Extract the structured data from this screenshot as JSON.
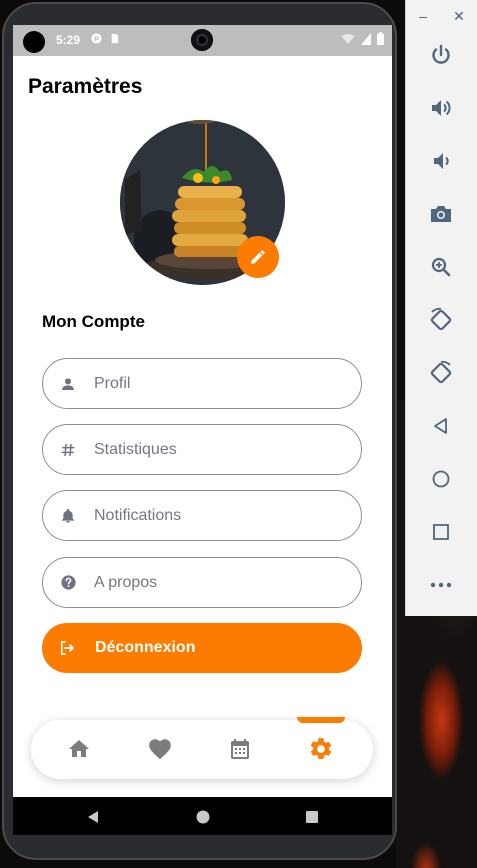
{
  "status_bar": {
    "time": "5:29"
  },
  "page": {
    "title": "Paramètres"
  },
  "account": {
    "section_title": "Mon Compte",
    "items": [
      {
        "label": "Profil",
        "icon": "person-icon"
      },
      {
        "label": "Statistiques",
        "icon": "hash-icon"
      },
      {
        "label": "Notifications",
        "icon": "bell-icon"
      },
      {
        "label": "A propos",
        "icon": "help-icon"
      }
    ],
    "logout_label": "Déconnexion"
  },
  "bottom_nav": {
    "items": [
      {
        "name": "home",
        "icon": "home-icon",
        "active": false
      },
      {
        "name": "favorites",
        "icon": "heart-icon",
        "active": false
      },
      {
        "name": "calendar",
        "icon": "calendar-icon",
        "active": false
      },
      {
        "name": "settings",
        "icon": "gear-icon",
        "active": true
      }
    ]
  },
  "emulator_panel": {
    "window_controls": {
      "minimize": "–",
      "close": "✕"
    }
  },
  "colors": {
    "accent": "#fb7c00",
    "icon_gray": "#6f7280",
    "border": "#8b8e96"
  }
}
